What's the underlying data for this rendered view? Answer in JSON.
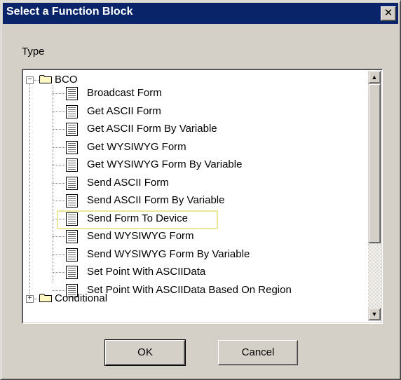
{
  "window": {
    "title": "Select a Function Block",
    "close_glyph": "✕"
  },
  "type_label": "Type",
  "tree": {
    "root": {
      "label": "BCO",
      "expander": "−",
      "icon": "folder-icon"
    },
    "items": [
      "Broadcast Form",
      "Get ASCII Form",
      "Get ASCII Form By Variable",
      "Get WYSIWYG Form",
      "Get WYSIWYG Form By Variable",
      "Send ASCII Form",
      "Send ASCII Form By Variable",
      "Send Form To Device",
      "Send WYSIWYG Form",
      "Send WYSIWYG Form By Variable",
      "Set Point With ASCIIData",
      "Set Point With ASCIIData Based On Region"
    ],
    "highlighted_item": "Send Form To Device",
    "next_folder": {
      "label": "Conditional",
      "expander": "+",
      "icon": "folder-icon"
    }
  },
  "scrollbar": {
    "up_glyph": "▲",
    "down_glyph": "▼"
  },
  "buttons": {
    "ok": "OK",
    "cancel": "Cancel"
  },
  "colors": {
    "titlebar": "#0a246a",
    "face": "#d4d0c8",
    "highlight_border": "#e8e898"
  }
}
